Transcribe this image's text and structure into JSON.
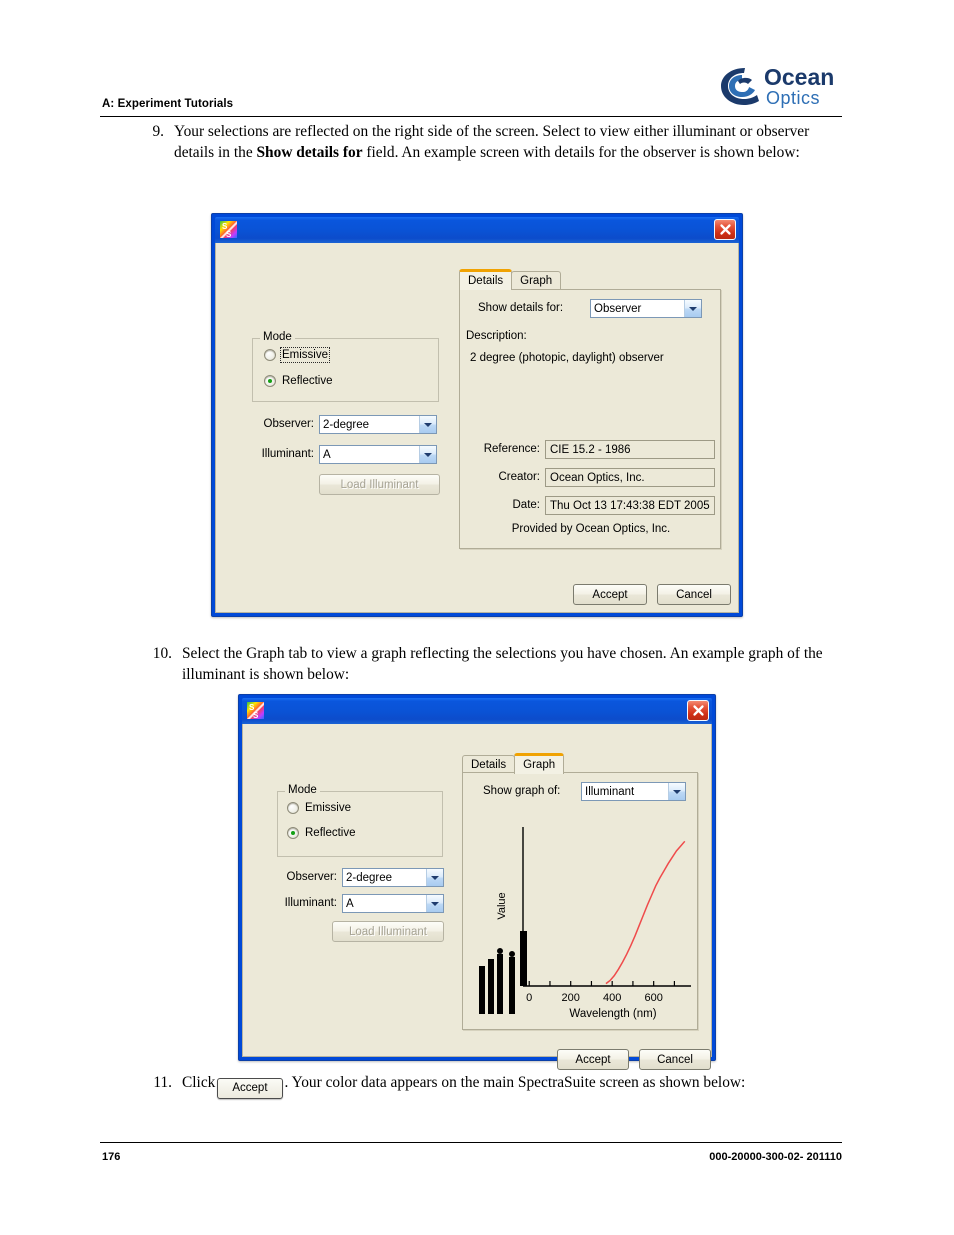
{
  "page": {
    "header_label": "A: Experiment Tutorials",
    "logo": {
      "word_top": "Ocean",
      "word_bottom": "Optics",
      "navy": "#1b3a6b",
      "blue": "#2e6fb5"
    },
    "footer_page_number": "176",
    "footer_doc_number": "000-20000-300-02- 201110"
  },
  "steps": {
    "step9": {
      "number": "9.",
      "text_a": "Your selections are reflected on the right side of the screen. Select to view either illuminant or observer details in the ",
      "text_bold": "Show details for",
      "text_b": " field. An example screen with details for the observer is shown below:"
    },
    "step10": {
      "number": "10.",
      "text": "Select the Graph tab to view a graph reflecting the selections you have chosen. An example graph of the illuminant is shown below:"
    },
    "step11": {
      "number": "11.",
      "text_a": "Click",
      "button_label": "Accept",
      "text_b": ". Your color data appears on the main SpectraSuite screen as shown below:"
    }
  },
  "dialog_details": {
    "app_icon": "spectrasuite-icon",
    "close_icon": "close-icon",
    "mode_group": {
      "title": "Mode",
      "options": [
        {
          "label": "Emissive",
          "checked": false,
          "focused": true
        },
        {
          "label": "Reflective",
          "checked": true,
          "focused": false
        }
      ]
    },
    "observer": {
      "label": "Observer:",
      "value": "2-degree"
    },
    "illuminant": {
      "label": "Illuminant:",
      "value": "A"
    },
    "load_illuminant_button": "Load Illuminant",
    "tabs": [
      {
        "label": "Details",
        "active": true
      },
      {
        "label": "Graph",
        "active": false
      }
    ],
    "show_details_for": {
      "label": "Show details for:",
      "value": "Observer"
    },
    "description_label": "Description:",
    "description_value": "2 degree (photopic, daylight) observer",
    "reference": {
      "label": "Reference:",
      "value": "CIE 15.2 - 1986"
    },
    "creator": {
      "label": "Creator:",
      "value": "Ocean Optics, Inc."
    },
    "date": {
      "label": "Date:",
      "value": "Thu Oct 13 17:43:38 EDT 2005"
    },
    "provided_by": "Provided by Ocean Optics, Inc.",
    "accept_button": "Accept",
    "cancel_button": "Cancel"
  },
  "dialog_graph": {
    "app_icon": "spectrasuite-icon",
    "close_icon": "close-icon",
    "mode_group": {
      "title": "Mode",
      "options": [
        {
          "label": "Emissive",
          "checked": false,
          "focused": false
        },
        {
          "label": "Reflective",
          "checked": true,
          "focused": false
        }
      ]
    },
    "observer": {
      "label": "Observer:",
      "value": "2-degree"
    },
    "illuminant": {
      "label": "Illuminant:",
      "value": "A"
    },
    "load_illuminant_button": "Load Illuminant",
    "tabs": [
      {
        "label": "Details",
        "active": false
      },
      {
        "label": "Graph",
        "active": true
      }
    ],
    "show_graph_of": {
      "label": "Show graph of:",
      "value": "Illuminant"
    },
    "accept_button": "Accept",
    "cancel_button": "Cancel"
  },
  "chart_data": {
    "type": "line",
    "title": "",
    "xlabel": "Wavelength (nm)",
    "ylabel": "Value",
    "xticks": [
      0,
      200,
      400,
      600
    ],
    "xlim": [
      -30,
      780
    ],
    "ylim": [
      0,
      100
    ],
    "grid": false,
    "legend": false,
    "series": [
      {
        "name": "Illuminant A",
        "color": "#ef4b4b",
        "x": [
          370,
          390,
          410,
          430,
          450,
          470,
          490,
          510,
          530,
          550,
          570,
          590,
          610,
          630,
          650,
          670,
          690,
          710,
          730,
          750
        ],
        "values": [
          1.5,
          3.5,
          6.5,
          10.5,
          15.0,
          20.0,
          25.5,
          31.5,
          38.0,
          44.5,
          51.0,
          57.0,
          63.0,
          68.0,
          72.5,
          77.0,
          81.0,
          85.0,
          88.0,
          91.0
        ]
      }
    ],
    "axis_color": "#000000"
  }
}
